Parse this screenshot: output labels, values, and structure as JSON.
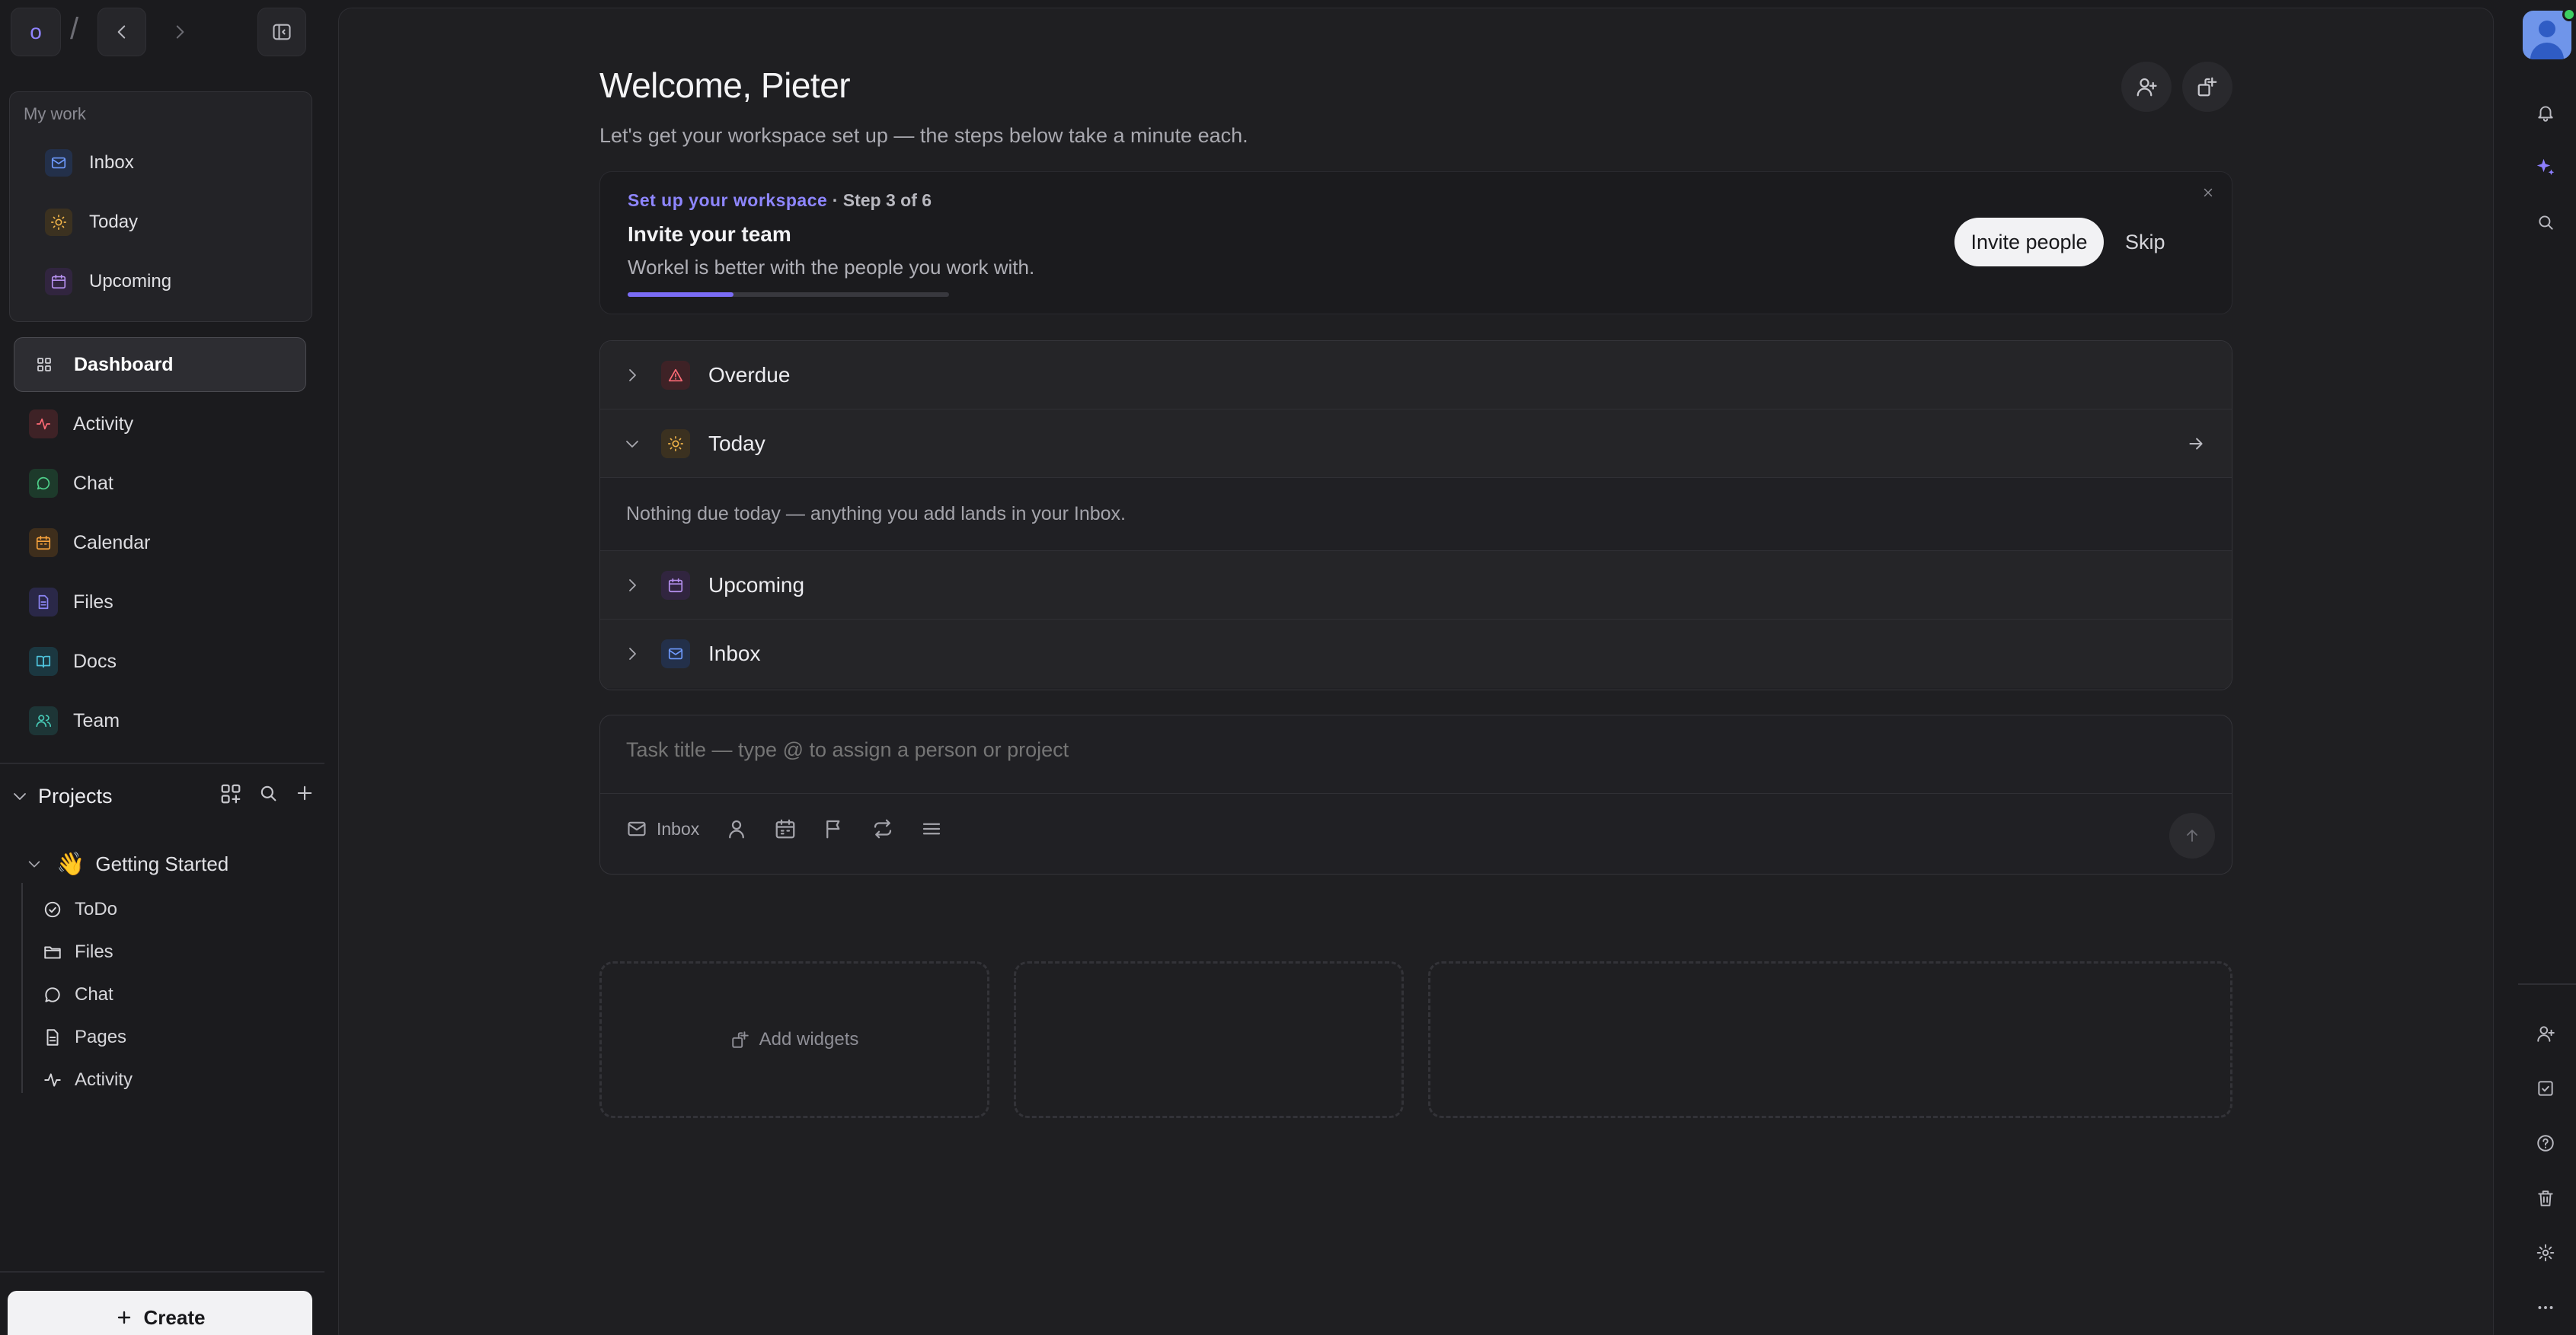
{
  "workspace": {
    "initial": "o",
    "separator": "/"
  },
  "sidebar": {
    "my_work": {
      "title": "My work",
      "items": [
        {
          "label": "Inbox",
          "icon": "inbox-icon"
        },
        {
          "label": "Today",
          "icon": "sun-icon"
        },
        {
          "label": "Upcoming",
          "icon": "calendar-icon"
        }
      ]
    },
    "nav": [
      {
        "label": "Dashboard",
        "icon": "grid-icon",
        "active": true
      },
      {
        "label": "Activity",
        "icon": "activity-icon"
      },
      {
        "label": "Chat",
        "icon": "chat-icon"
      },
      {
        "label": "Calendar",
        "icon": "calendar-icon"
      },
      {
        "label": "Files",
        "icon": "file-icon"
      },
      {
        "label": "Docs",
        "icon": "book-icon"
      },
      {
        "label": "Team",
        "icon": "users-icon"
      }
    ],
    "projects": {
      "title": "Projects",
      "project": {
        "emoji": "👋",
        "name": "Getting Started",
        "items": [
          {
            "label": "ToDo",
            "icon": "check-circle-icon"
          },
          {
            "label": "Files",
            "icon": "folder-icon"
          },
          {
            "label": "Chat",
            "icon": "chat-icon"
          },
          {
            "label": "Pages",
            "icon": "page-icon"
          },
          {
            "label": "Activity",
            "icon": "activity-icon"
          }
        ]
      }
    },
    "create_label": "Create"
  },
  "main": {
    "welcome": "Welcome, Pieter",
    "subtitle": "Let's get your workspace set up — the steps below take a minute each.",
    "setup": {
      "eyebrow": "Set up your workspace",
      "step": "· Step 3 of 6",
      "title": "Invite your team",
      "description": "Workel is better with the people you work with.",
      "progress": 0.33,
      "invite_label": "Invite people",
      "skip_label": "Skip"
    },
    "sections": [
      {
        "label": "Overdue",
        "icon": "warning-icon",
        "expanded": false
      },
      {
        "label": "Today",
        "icon": "sun-icon",
        "expanded": true
      },
      {
        "label": "Upcoming",
        "icon": "calendar-icon",
        "expanded": false
      },
      {
        "label": "Inbox",
        "icon": "inbox-icon",
        "expanded": false
      }
    ],
    "today_empty": "Nothing due today — anything you add lands in your Inbox.",
    "composer": {
      "placeholder": "Task title — type @ to assign a person or project",
      "inbox_label": "Inbox"
    },
    "add_widgets_label": "Add widgets"
  },
  "colors": {
    "accent": "#7a6cf5",
    "background": "#1b1b1e",
    "panel": "#1f1f22",
    "online": "#3ccf62"
  }
}
